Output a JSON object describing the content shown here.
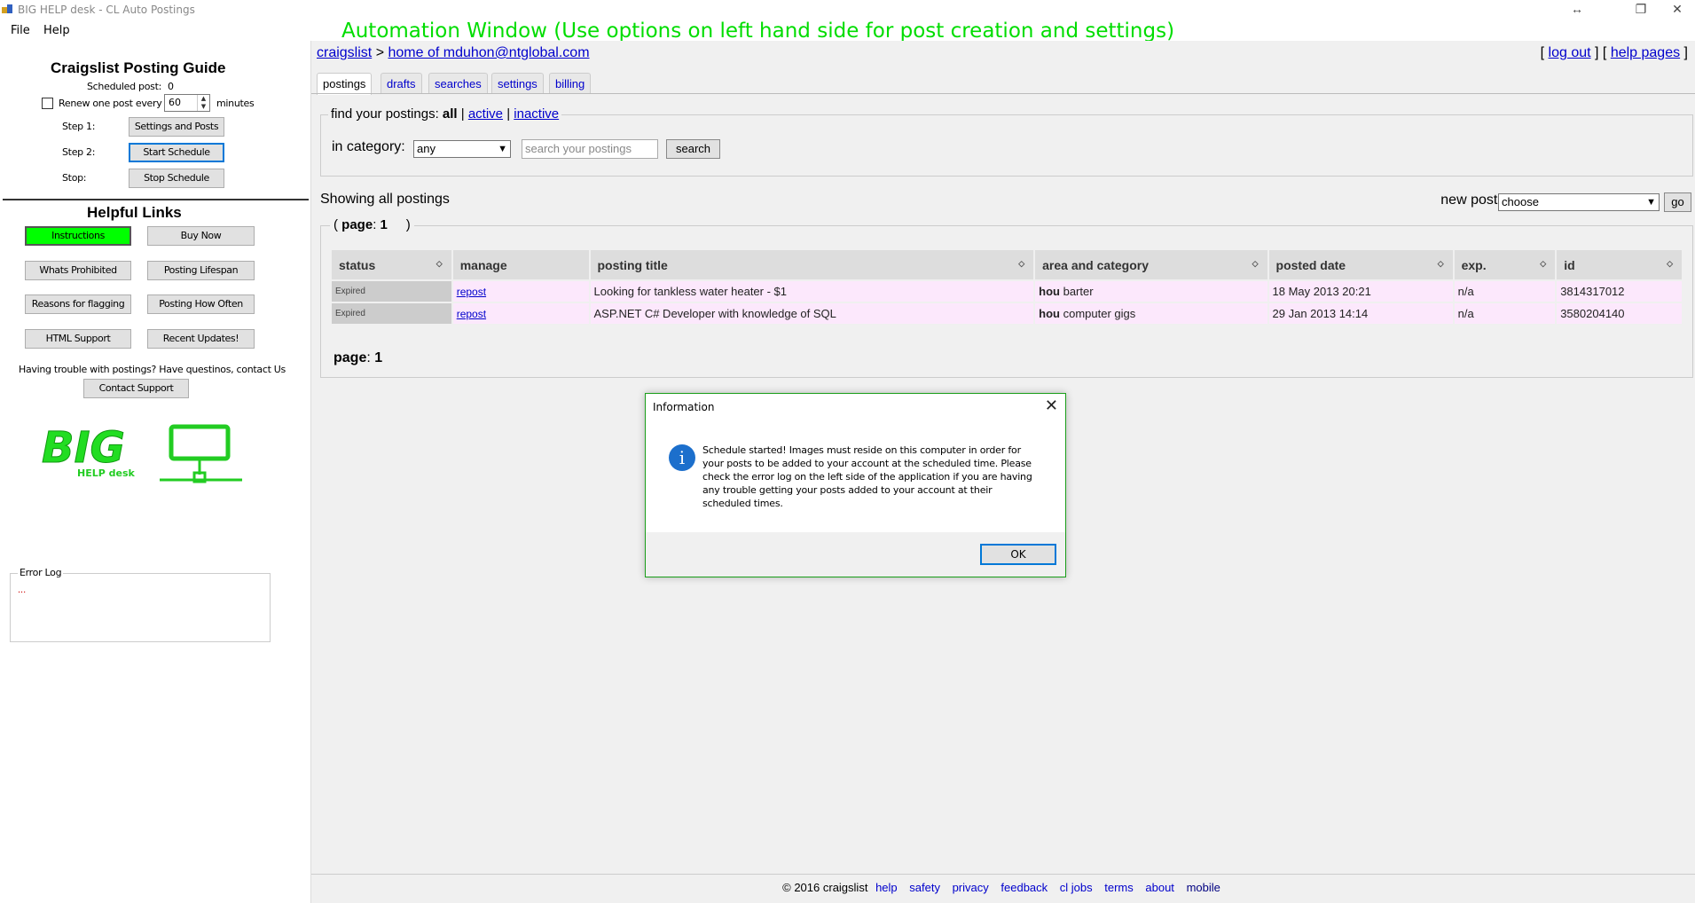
{
  "window": {
    "title": "BIG HELP desk - CL Auto Postings",
    "icon": "app-icon"
  },
  "menu": {
    "file": "File",
    "help": "Help"
  },
  "banner": "Automation Window (Use options on left hand side for post creation and settings)",
  "guide": {
    "title": "Craigslist Posting Guide",
    "scheduled_label": "Scheduled post:",
    "scheduled_value": "0",
    "renew_label": "Renew one post every",
    "renew_value": "60",
    "minutes_label": "minutes",
    "step1_label": "Step 1:",
    "step1_button": "Settings and Posts",
    "step2_label": "Step 2:",
    "step2_button": "Start Schedule",
    "stop_label": "Stop:",
    "stop_button": "Stop Schedule"
  },
  "links": {
    "title": "Helpful Links",
    "instructions": "Instructions",
    "buy_now": "Buy Now",
    "whats_prohibited": "Whats Prohibited",
    "posting_lifespan": "Posting Lifespan",
    "reasons_flagging": "Reasons for flagging",
    "posting_how_often": "Posting How Often",
    "html_support": "HTML Support",
    "recent_updates": "Recent Updates!",
    "trouble_text": "Having trouble with postings?  Have questinos, contact Us",
    "contact_support": "Contact Support"
  },
  "logo": {
    "big": "BIG",
    "sub": "HELP desk"
  },
  "error_log": {
    "label": "Error Log",
    "content": "..."
  },
  "web": {
    "breadcrumb_home": "craigslist",
    "breadcrumb_sep": ">",
    "breadcrumb_account": "home of mduhon@ntglobal.com",
    "logout": "log out",
    "help_pages": "help pages",
    "tabs": [
      "postings",
      "drafts",
      "searches",
      "settings",
      "billing"
    ],
    "find_label": "find your postings:",
    "filter_all": "all",
    "filter_active": "active",
    "filter_inactive": "inactive",
    "category_label": "in category:",
    "category_value": "any",
    "search_placeholder": "search your postings",
    "search_button": "search",
    "showing": "Showing all postings",
    "new_posting_label": "new posting in:",
    "new_posting_value": "choose",
    "go_button": "go",
    "page_label": "page",
    "page_value": "1",
    "columns": [
      "status",
      "manage",
      "posting title",
      "area and category",
      "posted date",
      "exp.",
      "id"
    ],
    "rows": [
      {
        "status": "Expired",
        "manage": "repost",
        "title": "Looking for tankless water heater - $1",
        "area": "hou",
        "category": "barter",
        "date": "18 May 2013 20:21",
        "exp": "n/a",
        "id": "3814317012"
      },
      {
        "status": "Expired",
        "manage": "repost",
        "title": "ASP.NET C# Developer with knowledge of SQL",
        "area": "hou",
        "category": "computer gigs",
        "date": "29 Jan 2013 14:14",
        "exp": "n/a",
        "id": "3580204140"
      }
    ],
    "footer": {
      "copyright": "© 2016 craigslist",
      "links": [
        "help",
        "safety",
        "privacy",
        "feedback",
        "cl jobs",
        "terms",
        "about",
        "mobile"
      ]
    }
  },
  "dialog": {
    "title": "Information",
    "message": "Schedule started!  Images must reside on this computer in order for your posts to be added to your account at the scheduled time.  Please check the error log on the left side of the application if you are having any trouble getting your posts added to your account at their scheduled times.",
    "ok": "OK"
  },
  "colors": {
    "banner": "#00dd00",
    "instructions": "#00ff00",
    "link": "#0000cc",
    "row": "#fce8fc"
  }
}
